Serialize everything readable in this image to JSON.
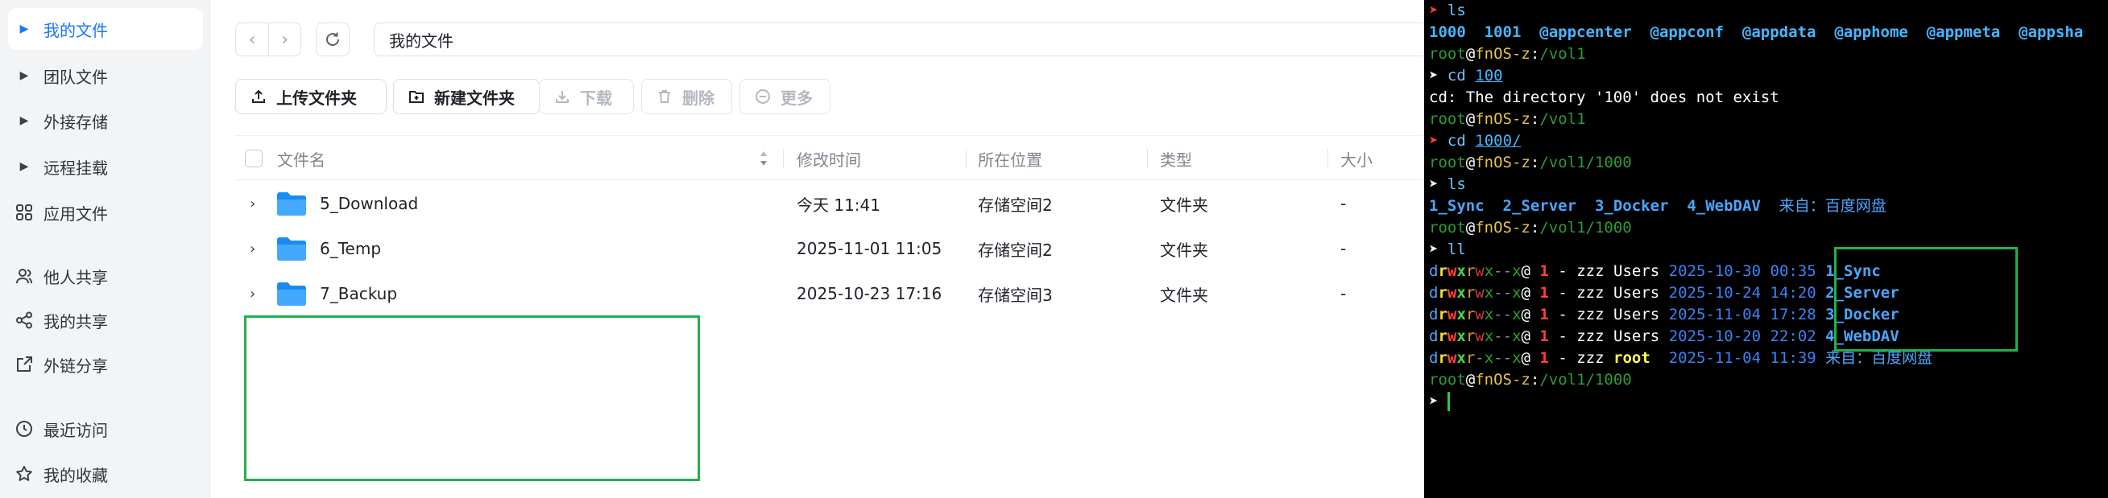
{
  "sidebar": {
    "items": [
      {
        "label": "我的文件",
        "active": true
      },
      {
        "label": "团队文件"
      },
      {
        "label": "外接存储"
      },
      {
        "label": "远程挂载"
      },
      {
        "label": "应用文件"
      },
      {
        "label": "他人共享"
      },
      {
        "label": "我的共享"
      },
      {
        "label": "外链分享"
      },
      {
        "label": "最近访问"
      },
      {
        "label": "我的收藏"
      }
    ]
  },
  "toolbar": {
    "path": "我的文件",
    "upload_folder": "上传文件夹",
    "new_folder": "新建文件夹",
    "download": "下载",
    "delete": "删除",
    "more": "更多"
  },
  "table": {
    "columns": [
      "文件名",
      "修改时间",
      "所在位置",
      "类型",
      "大小"
    ],
    "rows": [
      {
        "name": "5_Download",
        "modified": "今天 11:41",
        "location": "存储空间2",
        "type": "文件夹",
        "size": "-"
      },
      {
        "name": "6_Temp",
        "modified": "2025-11-01 11:05",
        "location": "存储空间2",
        "type": "文件夹",
        "size": "-"
      },
      {
        "name": "7_Backup",
        "modified": "2025-10-23 17:16",
        "location": "存储空间3",
        "type": "文件夹",
        "size": "-"
      }
    ]
  },
  "terminal": {
    "prompt_arrow": "➤",
    "user": "root",
    "host": "fnOS-z",
    "line_ls1_cmd": "ls",
    "line_ls1_out": "1000  1001  @appcenter  @appconf  @appdata  @apphome  @appmeta  @appsha",
    "cwd_vol1": "/vol1",
    "cd100_cmd": "cd",
    "cd100_arg": "100",
    "cd100_err": "cd: The directory '100' does not exist",
    "cd1000_cmd": "cd",
    "cd1000_arg": "1000/",
    "cwd_1000": "/vol1/1000",
    "ls2_cmd": "ls",
    "ls2_out": [
      "1_Sync",
      "2_Server",
      "3_Docker",
      "4_WebDAV"
    ],
    "ls2_extra": "来自：百度网盘",
    "ll_cmd": "ll",
    "ll_rows": [
      {
        "links": "1",
        "owner": "zzz",
        "group": "Users",
        "date": "2025-10-30 00:35",
        "name": "1_Sync"
      },
      {
        "links": "1",
        "owner": "zzz",
        "group": "Users",
        "date": "2025-10-24 14:20",
        "name": "2_Server"
      },
      {
        "links": "1",
        "owner": "zzz",
        "group": "Users",
        "date": "2025-11-04 17:28",
        "name": "3_Docker"
      },
      {
        "links": "1",
        "owner": "zzz",
        "group": "Users",
        "date": "2025-10-20 22:02",
        "name": "4_WebDAV"
      },
      {
        "links": "1",
        "owner": "zzz",
        "group": "root",
        "date": "2025-11-04 11:39",
        "name": "来自：百度网盘"
      }
    ],
    "ll_dash": "-"
  },
  "colors": {
    "accent": "#1677ff",
    "highlight_box": "#22b14c",
    "terminal_bg": "#000000"
  }
}
